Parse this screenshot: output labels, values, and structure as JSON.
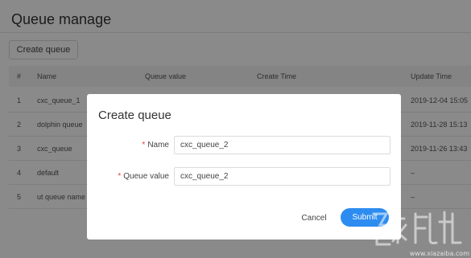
{
  "page": {
    "title": "Queue manage"
  },
  "toolbar": {
    "create_label": "Create queue"
  },
  "table": {
    "headers": [
      "#",
      "Name",
      "Queue value",
      "Create Time",
      "Update Time"
    ],
    "rows": [
      {
        "num": "1",
        "name": "cxc_queue_1",
        "update": "2019-12-04 15:05"
      },
      {
        "num": "2",
        "name": "dolphin queue",
        "update": "2019-11-28 15:13"
      },
      {
        "num": "3",
        "name": "cxc_queue",
        "update": "2019-11-26 13:43"
      },
      {
        "num": "4",
        "name": "default",
        "update": "–"
      },
      {
        "num": "5",
        "name": "ut queue name",
        "update": "–"
      }
    ]
  },
  "modal": {
    "title": "Create queue",
    "name_label": "Name",
    "name_value": "cxc_queue_2",
    "value_label": "Queue value",
    "value_value": "cxc_queue_2",
    "required_mark": "*",
    "cancel_label": "Cancel",
    "submit_label": "Submit"
  },
  "watermark": {
    "url": "www.xiazaiba.com"
  },
  "colors": {
    "primary": "#2d8cf0",
    "required": "#e9413c",
    "overlay": "rgba(0,0,0,0.46)"
  }
}
